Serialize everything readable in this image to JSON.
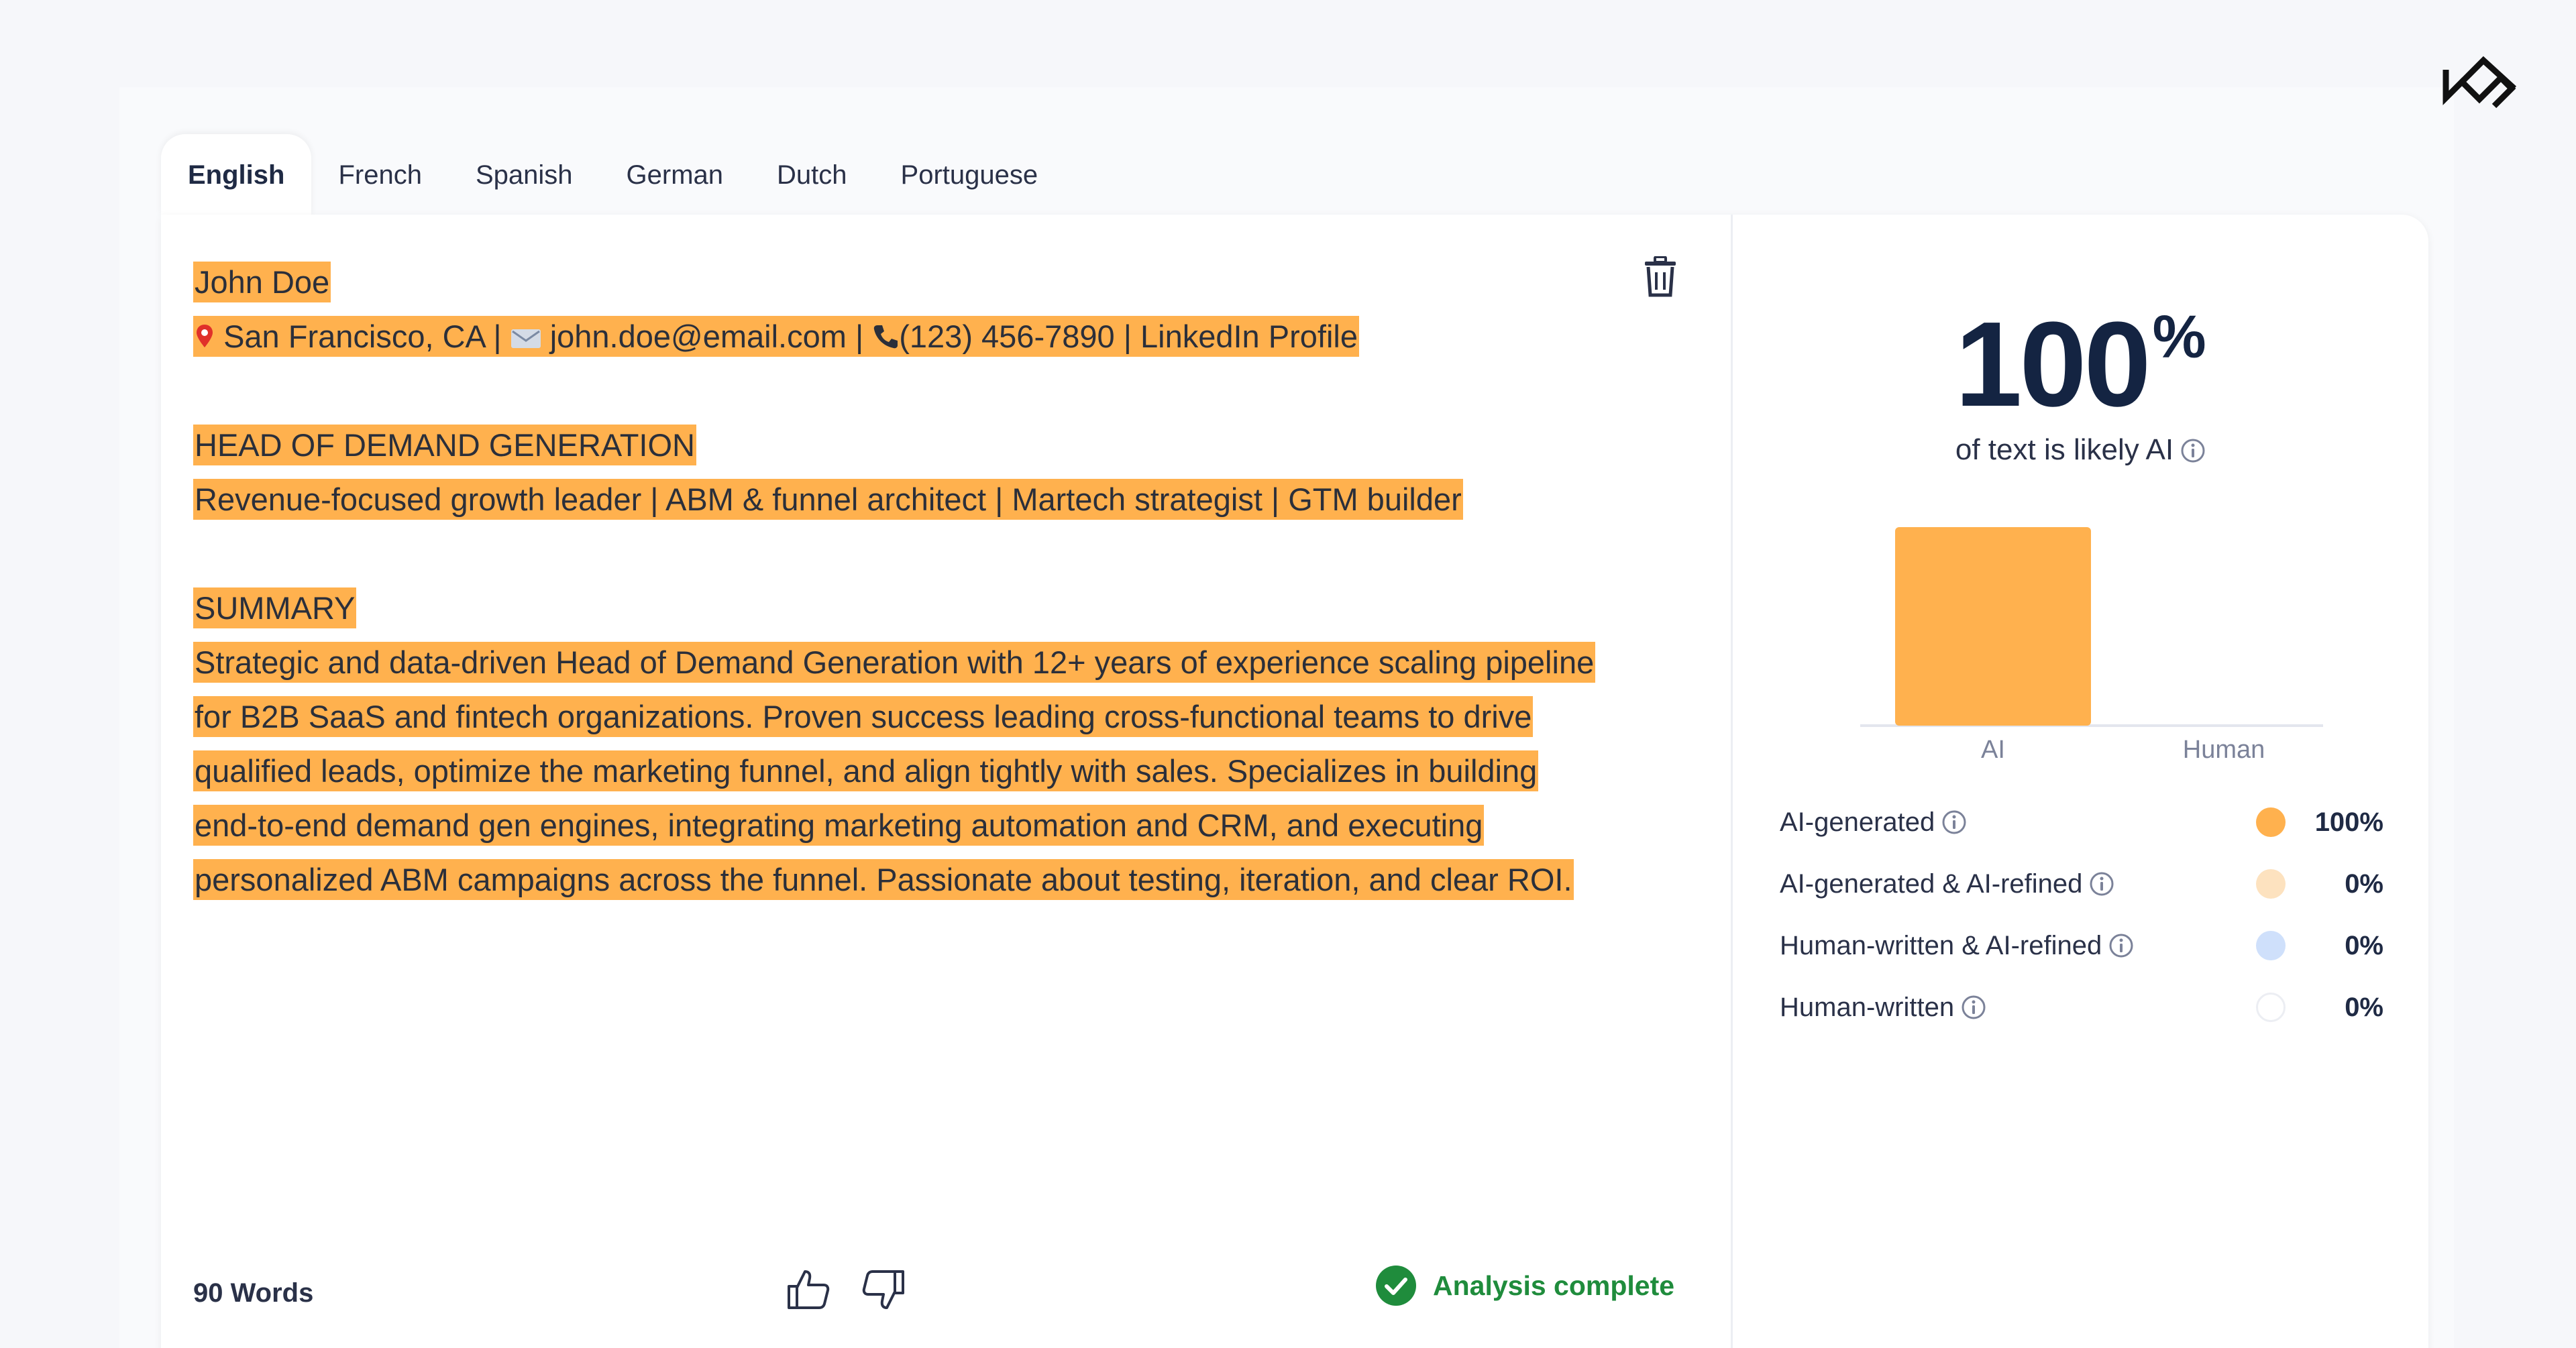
{
  "tabs": [
    "English",
    "French",
    "Spanish",
    "German",
    "Dutch",
    "Portuguese"
  ],
  "document": {
    "name": "John Doe",
    "location": "San Francisco, CA",
    "email": "john.doe@email.com",
    "phone": "(123) 456-7890",
    "linkedin": "LinkedIn Profile",
    "sep": "|",
    "title": "HEAD OF DEMAND GENERATION",
    "tagline": "Revenue-focused growth leader | ABM & funnel architect | Martech strategist | GTM builder",
    "summary_heading": "SUMMARY",
    "summary_lines": [
      "Strategic and data-driven Head of Demand Generation with 12+ years of experience scaling pipeline",
      "for B2B SaaS and fintech organizations. Proven success leading cross-functional teams to drive",
      "qualified leads, optimize the marketing funnel, and align tightly with sales. Specializes in building",
      "end-to-end demand gen engines, integrating marketing automation and CRM, and executing",
      "personalized ABM campaigns across the funnel. Passionate about testing, iteration, and clear ROI."
    ]
  },
  "footer": {
    "word_count": "90 Words",
    "status": "Analysis complete"
  },
  "result": {
    "percent": "100",
    "percent_symbol": "%",
    "subtitle": "of text is likely AI",
    "legend": [
      {
        "label": "AI-generated",
        "value": "100%",
        "color": "#ffb14e"
      },
      {
        "label": "AI-generated & AI-refined",
        "value": "0%",
        "color": "#fde2bf"
      },
      {
        "label": "Human-written & AI-refined",
        "value": "0%",
        "color": "#cfe0fb"
      },
      {
        "label": "Human-written",
        "value": "0%",
        "color": "#ffffff"
      }
    ]
  },
  "chart_data": {
    "type": "bar",
    "categories": [
      "AI",
      "Human"
    ],
    "values": [
      100,
      0
    ],
    "ylim": [
      0,
      100
    ],
    "colors": [
      "#ffb14e",
      "#ffb14e"
    ],
    "grid": false
  },
  "icons": {
    "logo": "brand-logo-icon",
    "trash": "trash-icon",
    "pin": "location-pin-icon",
    "mail": "mail-icon",
    "phone": "phone-icon",
    "info": "info-icon",
    "thumbs_up": "thumbs-up-icon",
    "thumbs_down": "thumbs-down-icon",
    "check": "check-circle-icon"
  }
}
